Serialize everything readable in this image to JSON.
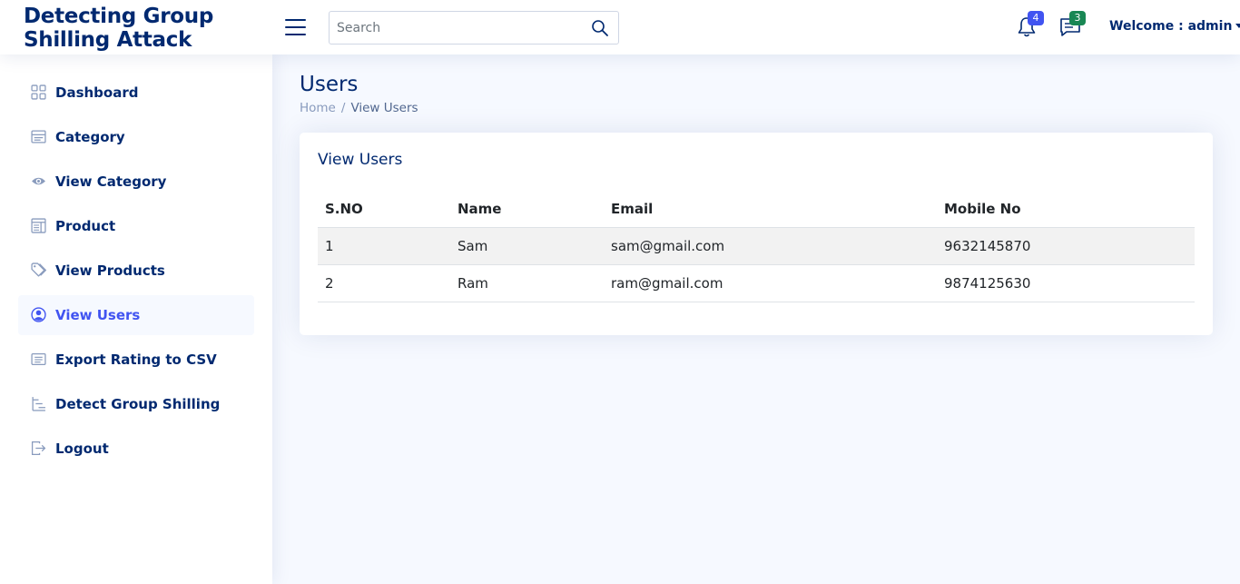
{
  "header": {
    "logo_line1": "Detecting Group",
    "logo_line2": "Shilling Attack",
    "search_placeholder": "Search",
    "notifications_count": "4",
    "messages_count": "3",
    "profile_label": "Welcome : admin"
  },
  "sidebar": {
    "items": [
      {
        "label": "Dashboard",
        "icon": "grid-icon"
      },
      {
        "label": "Category",
        "icon": "layout-text-icon"
      },
      {
        "label": "View Category",
        "icon": "eye-icon"
      },
      {
        "label": "Product",
        "icon": "layout-text-window-icon"
      },
      {
        "label": "View Products",
        "icon": "tags-icon"
      },
      {
        "label": "View Users",
        "icon": "person-circle-icon",
        "active": true
      },
      {
        "label": "Export Rating to CSV",
        "icon": "card-list-icon"
      },
      {
        "label": "Detect Group Shilling",
        "icon": "list-nested-icon"
      },
      {
        "label": "Logout",
        "icon": "box-arrow-right-icon"
      }
    ]
  },
  "main": {
    "page_title": "Users",
    "breadcrumb": {
      "home": "Home",
      "separator": "/",
      "current": "View Users"
    },
    "card_title": "View Users",
    "table": {
      "headers": [
        "S.NO",
        "Name",
        "Email",
        "Mobile No"
      ],
      "rows": [
        [
          "1",
          "Sam",
          "sam@gmail.com",
          "9632145870"
        ],
        [
          "2",
          "Ram",
          "ram@gmail.com",
          "9874125630"
        ]
      ]
    }
  },
  "colors": {
    "primary": "#012970",
    "accent": "#4154f1",
    "badge_blue": "#4154f1",
    "badge_green": "#198754",
    "background": "#f6f9ff"
  }
}
